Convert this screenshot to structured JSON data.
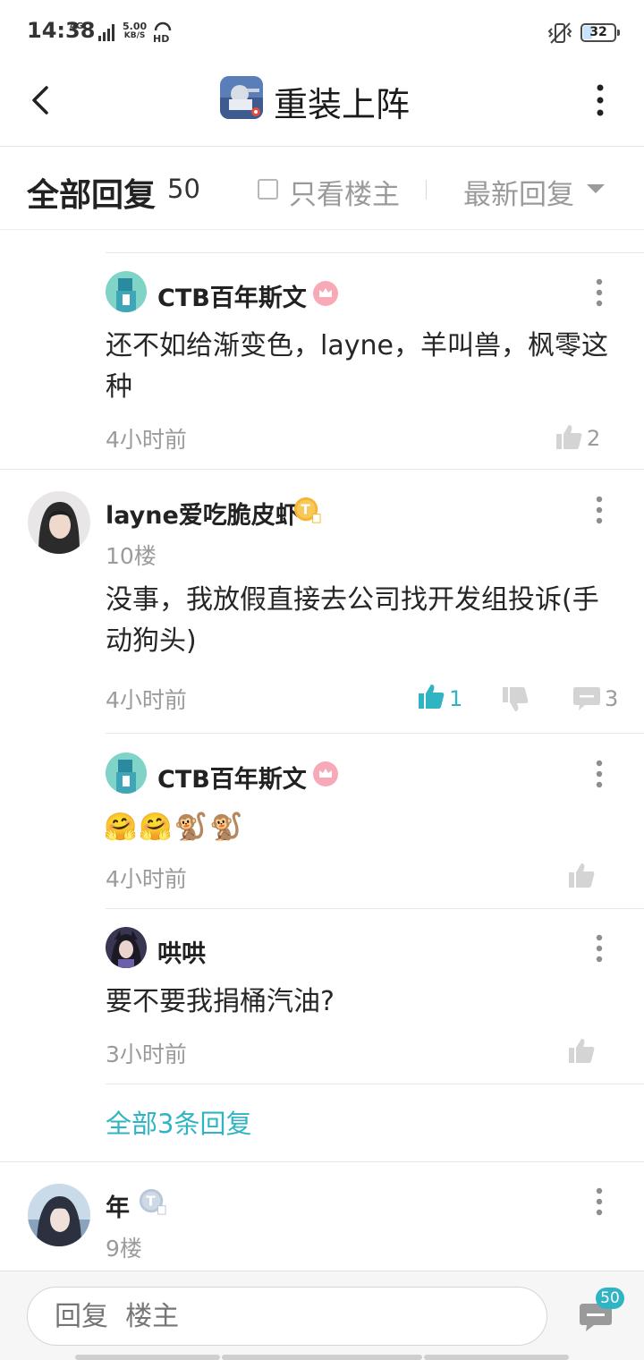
{
  "status_bar": {
    "time": "14:38",
    "network": "4G",
    "speed_top": "5.00",
    "speed_unit": "KB/S",
    "hd": "HD",
    "battery": "32"
  },
  "nav": {
    "title": "重装上阵",
    "back_icon": "chevron-left-icon",
    "more_icon": "more-vertical-icon"
  },
  "filter": {
    "title": "全部回复",
    "count": "50",
    "only_op": "只看楼主",
    "sort": "最新回复"
  },
  "threads": [
    {
      "sub_replies": [
        {
          "user": "CTB百年斯文",
          "content_line1": "还不如给渐变色，layne，羊叫兽，枫零这",
          "content_line2": "种",
          "time": "4小时前",
          "likes": "2"
        }
      ]
    },
    {
      "user": "layne爱吃脆皮虾",
      "level_badge": "T",
      "floor": "10楼",
      "content_line1": "没事，我放假直接去公司找开发组投诉(手",
      "content_line2": "动狗头)",
      "time": "4小时前",
      "likes": "1",
      "replies": "3",
      "sub_replies": [
        {
          "user": "CTB百年斯文",
          "content": "🤗🤗🐒🐒",
          "time": "4小时前"
        },
        {
          "user": "哄哄",
          "content": "要不要我捐桶汽油?",
          "time": "3小时前"
        }
      ],
      "all_replies_link": "全部3条回复"
    },
    {
      "user": "年",
      "level_badge": "T",
      "floor": "9楼"
    }
  ],
  "input": {
    "placeholder": "回复  楼主",
    "badge": "50"
  },
  "colors": {
    "accent": "#2fb4c4",
    "text_muted": "#9b9b9b",
    "like_active": "#2fb4c4"
  }
}
